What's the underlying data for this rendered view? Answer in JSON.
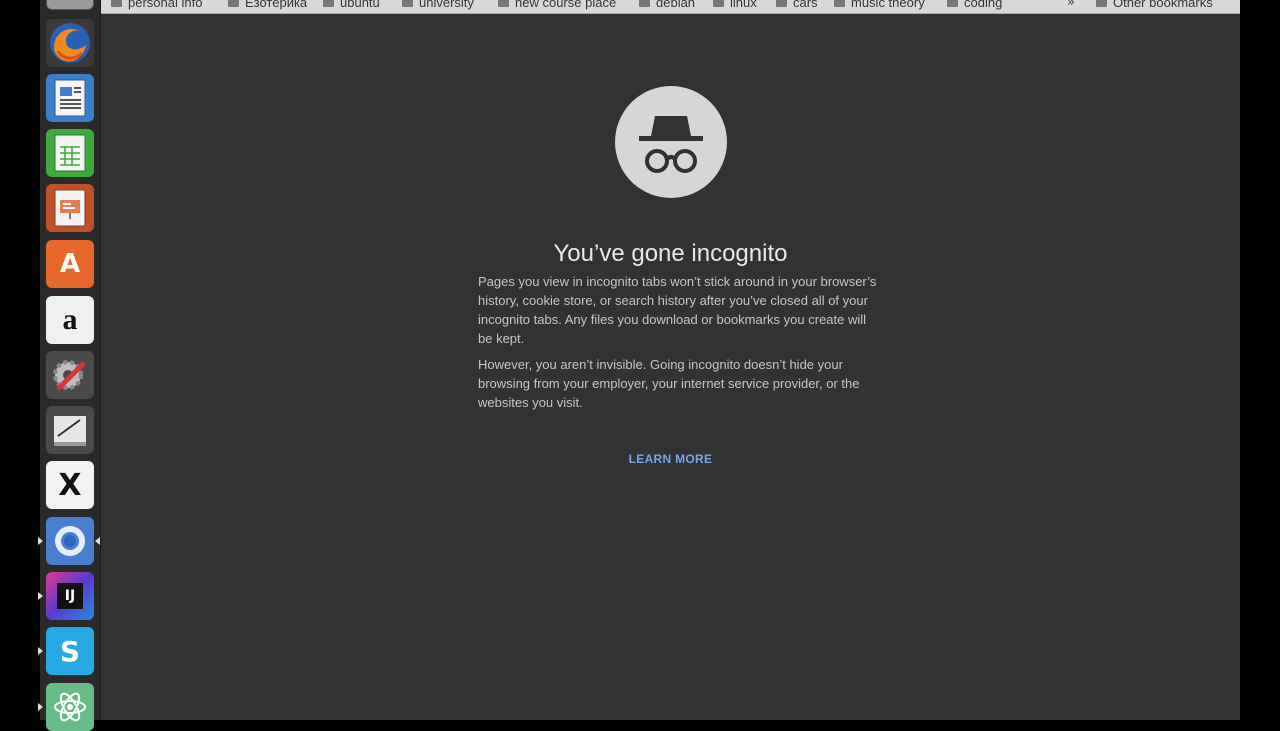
{
  "bookmarks": [
    "personal info",
    "Езотерика",
    "ubuntu",
    "university",
    "new course place",
    "debian",
    "linux",
    "cars",
    "music theory",
    "coding"
  ],
  "bookmarks_overflow": "»",
  "other_bookmarks": "Other bookmarks",
  "launcher": [
    {
      "name": "firefox-icon"
    },
    {
      "name": "libreoffice-writer-icon"
    },
    {
      "name": "libreoffice-calc-icon"
    },
    {
      "name": "libreoffice-impress-icon"
    },
    {
      "name": "ubuntu-software-center-icon",
      "glyph": "A"
    },
    {
      "name": "amazon-icon",
      "glyph": "a"
    },
    {
      "name": "system-settings-icon"
    },
    {
      "name": "text-editor-icon"
    },
    {
      "name": "xournal-icon",
      "glyph": "X"
    },
    {
      "name": "chromium-icon"
    },
    {
      "name": "intellij-idea-icon",
      "glyph": "IJ"
    },
    {
      "name": "skype-icon",
      "glyph": "S"
    },
    {
      "name": "atom-icon"
    }
  ],
  "incognito": {
    "title": "You’ve gone incognito",
    "paragraph1": "Pages you view in incognito tabs won’t stick around in your browser’s history, cookie store, or search history after you’ve closed all of your incognito tabs. Any files you download or bookmarks you create will be kept.",
    "paragraph2": "However, you aren’t invisible. Going incognito doesn’t hide your browsing from your employer, your internet service provider, or the websites you visit.",
    "learn_more": "LEARN MORE"
  },
  "colors": {
    "page_background": "#323232",
    "link": "#7aa7e8",
    "launcher_background": "#2a2a2a"
  }
}
